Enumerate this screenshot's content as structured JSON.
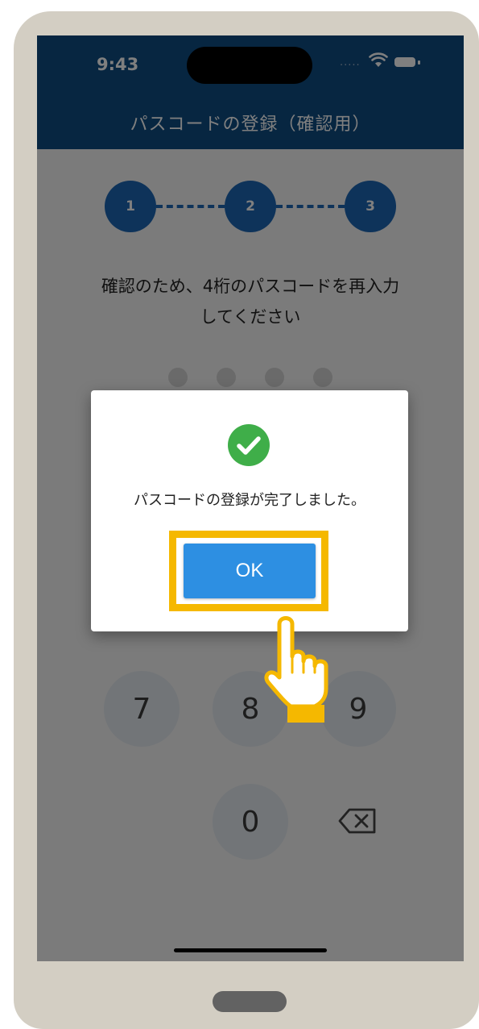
{
  "status_bar": {
    "time": "9:43",
    "signal_dots": "....."
  },
  "header": {
    "title": "パスコードの登録（確認用）"
  },
  "stepper": {
    "steps": [
      "1",
      "2",
      "3"
    ]
  },
  "instruction": {
    "line1": "確認のため、4桁のパスコードを再入力",
    "line2": "してください"
  },
  "keypad": {
    "keys": [
      "7",
      "8",
      "9",
      "0"
    ]
  },
  "dialog": {
    "message": "パスコードの登録が完了しました。",
    "ok_label": "OK"
  },
  "colors": {
    "header_bg": "#0f4c83",
    "step_active": "#1c67b4",
    "ok_button": "#2d8fe2",
    "success": "#3fae49",
    "highlight": "#f5b800"
  }
}
